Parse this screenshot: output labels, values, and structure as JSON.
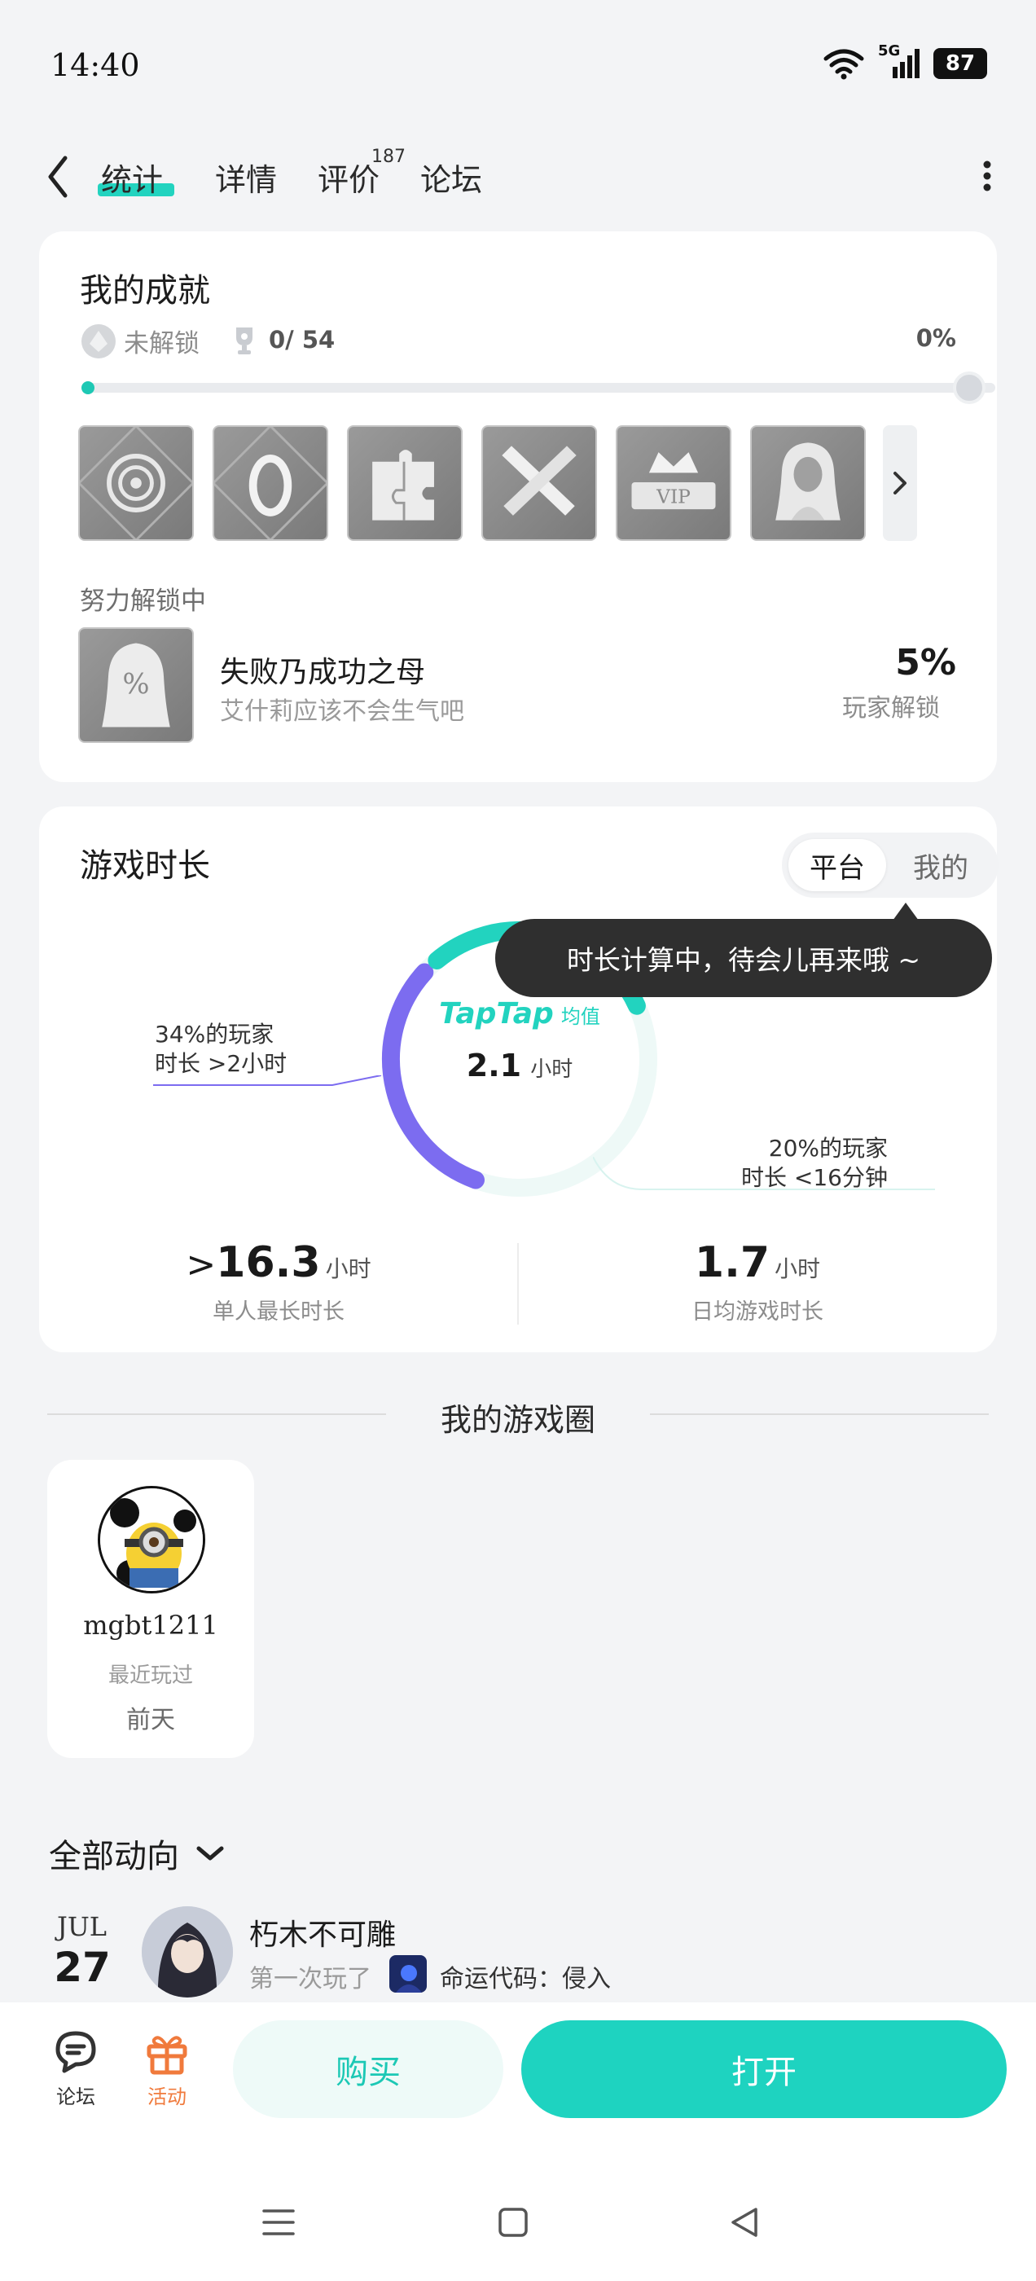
{
  "status_bar": {
    "time": "14:40",
    "network": "5G",
    "battery": "87"
  },
  "nav": {
    "tabs": [
      {
        "label": "统计"
      },
      {
        "label": "详情"
      },
      {
        "label": "评价"
      },
      {
        "label": "论坛"
      }
    ],
    "review_count": "187"
  },
  "achievements": {
    "title": "我的成就",
    "unlocked_label": "未解锁",
    "trophy_count": "0/ 54",
    "percent": "0%",
    "progress": 0,
    "badges": [
      {
        "icon": "target-badge-icon"
      },
      {
        "icon": "zero-badge-icon"
      },
      {
        "icon": "puzzle-badge-icon"
      },
      {
        "icon": "crossed-arms-badge-icon"
      },
      {
        "icon": "vip-crown-badge-icon"
      },
      {
        "icon": "character-badge-icon"
      }
    ],
    "in_progress_label": "努力解锁中",
    "current": {
      "name": "失败乃成功之母",
      "description": "艾什莉应该不会生气吧",
      "percent": "5%",
      "percent_label": "玩家解锁"
    }
  },
  "playtime": {
    "title": "游戏时长",
    "toggle_platform": "平台",
    "toggle_mine": "我的",
    "tooltip": "时长计算中，待会儿再来哦 ~",
    "donut": {
      "brand": "TapTap",
      "avg_label": "均值",
      "value": "2.1",
      "unit": "小时",
      "segments": [
        {
          "label": "34%的玩家",
          "detail": "时长 >2小时",
          "percent": 34,
          "color": "#7c6cf0"
        },
        {
          "label": "20%的玩家",
          "detail": "时长 <16分钟",
          "percent": 20,
          "color": "#eef9f7"
        },
        {
          "percent": 46,
          "color": "#22d3bf"
        }
      ]
    },
    "max_single": {
      "prefix": ">",
      "value": "16.3",
      "unit": "小时",
      "label": "单人最长时长"
    },
    "daily_avg": {
      "value": "1.7",
      "unit": "小时",
      "label": "日均游戏时长"
    }
  },
  "circle": {
    "title": "我的游戏圈",
    "friend": {
      "name": "mgbt1211",
      "status": "最近玩过",
      "when": "前天"
    }
  },
  "activity": {
    "filter_label": "全部动向",
    "items": [
      {
        "month": "JUL",
        "day": "27",
        "user": "朽木不可雕",
        "action": "第一次玩了",
        "game": "命运代码：侵入"
      }
    ]
  },
  "bottom_bar": {
    "forum_label": "论坛",
    "activity_label": "活动",
    "buy_label": "购买",
    "open_label": "打开"
  },
  "colors": {
    "accent": "#1ed3c0",
    "purple": "#7c6cf0",
    "orange": "#f07a3c"
  }
}
